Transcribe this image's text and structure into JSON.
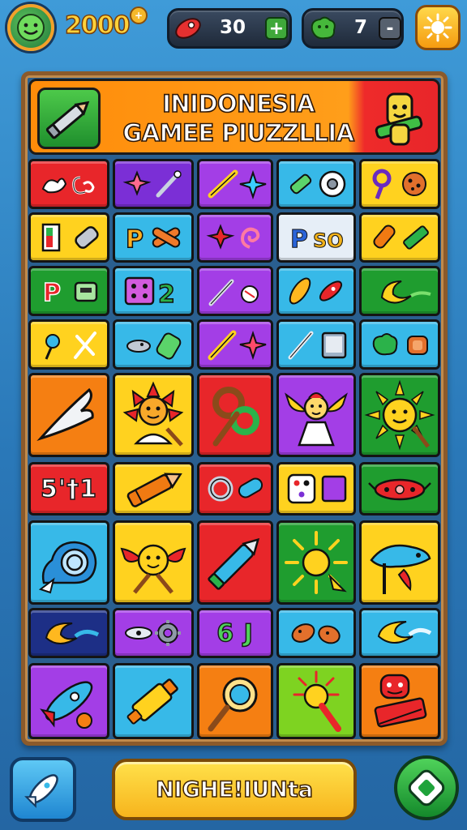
{
  "hud": {
    "avatar_icon": "green-face-icon",
    "coins": "2000",
    "coin_badge": "+",
    "resource_1": {
      "icon": "red-rocket-icon",
      "value": "30",
      "button": "+"
    },
    "resource_2": {
      "icon": "green-blob-icon",
      "value": "7",
      "button": "-"
    },
    "settings_icon": "sun-icon"
  },
  "banner": {
    "title_line1": "INIDONESIA",
    "title_line2": "GAMEE PIUZZLLIA",
    "left_icon": "pencil-icon",
    "right_icon": "mascot-icon"
  },
  "tiles": {
    "r8c0_text": "5'†1",
    "r10c2_text": "6 J"
  },
  "bottom": {
    "left_icon": "rocket-icon",
    "main_label": "NIGHE!IUNta",
    "right_icon": "game-pad-icon"
  },
  "colors": {
    "background": "#3f9bd8",
    "banner_orange": "#ff8c0a",
    "banner_red": "#e8262a",
    "frame_brown": "#8b5a2b",
    "red": "#e8262a",
    "purple": "#8b3ee0",
    "yellow": "#ffd21f",
    "cyan": "#37b9e8",
    "green": "#1f9d2f",
    "orange": "#f57f12",
    "navy": "#1d2f86"
  }
}
